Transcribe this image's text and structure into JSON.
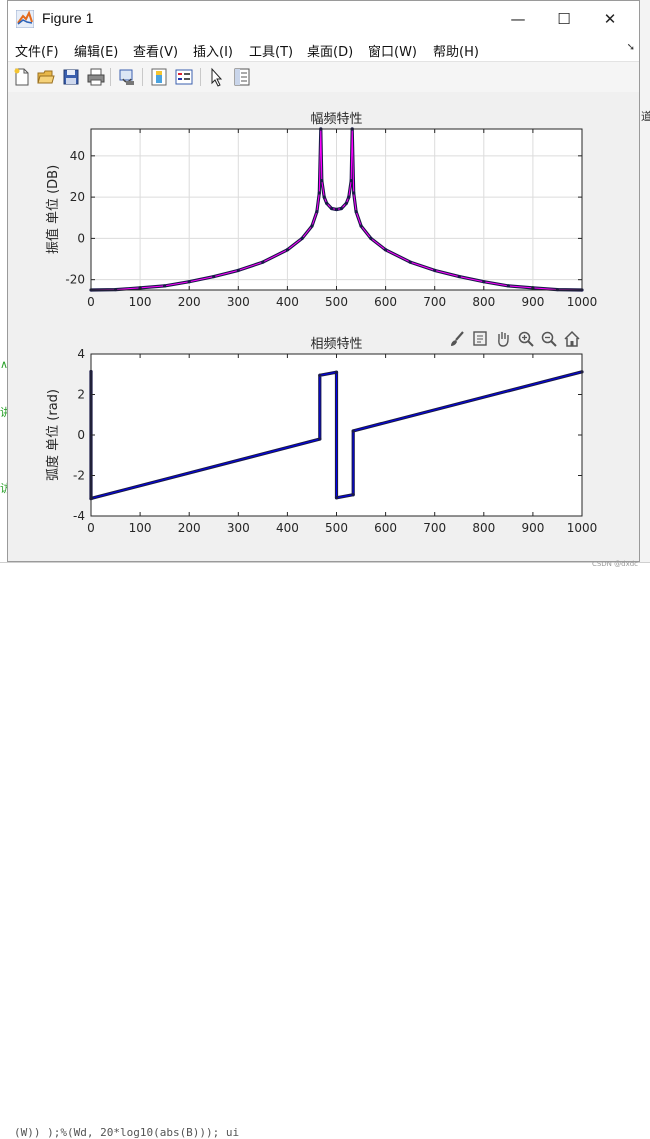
{
  "window": {
    "title": "Figure 1",
    "minimize": "—",
    "maximize": "☐",
    "close": "✕"
  },
  "menu": [
    {
      "label": "文件(F)"
    },
    {
      "label": "编辑(E)"
    },
    {
      "label": "查看(V)"
    },
    {
      "label": "插入(I)"
    },
    {
      "label": "工具(T)"
    },
    {
      "label": "桌面(D)"
    },
    {
      "label": "窗口(W)"
    },
    {
      "label": "帮助(H)"
    }
  ],
  "toolbar": {
    "icons": [
      "new-figure-icon",
      "open-file-icon",
      "save-icon",
      "print-icon",
      "link-plot-icon",
      "insert-colorbar-icon",
      "insert-legend-icon",
      "edit-plot-icon",
      "property-inspector-icon"
    ]
  },
  "axes_toolbar": {
    "icons": [
      "brush-icon",
      "data-tips-icon",
      "pan-icon",
      "zoom-in-icon",
      "zoom-out-icon",
      "home-icon"
    ]
  },
  "chart_data": [
    {
      "type": "line",
      "title": "幅频特性",
      "xlabel": "",
      "ylabel": "振值  单位 (DB)",
      "xlim": [
        0,
        1000
      ],
      "ylim": [
        -25,
        53
      ],
      "xticks": [
        0,
        100,
        200,
        300,
        400,
        500,
        600,
        700,
        800,
        900,
        1000
      ],
      "yticks": [
        -20,
        0,
        20,
        40
      ],
      "grid": true,
      "series": [
        {
          "color": "#ff00ff",
          "marker_color": "#1a1a4a",
          "x": [
            0,
            50,
            100,
            150,
            200,
            250,
            300,
            350,
            400,
            430,
            450,
            460,
            465,
            468,
            470,
            475,
            480,
            490,
            500,
            510,
            520,
            525,
            530,
            532,
            535,
            540,
            550,
            570,
            600,
            650,
            700,
            750,
            800,
            850,
            900,
            950,
            1000
          ],
          "values": [
            -25,
            -24.8,
            -24,
            -23,
            -21,
            -18.5,
            -15.5,
            -11.5,
            -5.5,
            0,
            6,
            13,
            22,
            53,
            28,
            20,
            17,
            14.5,
            14,
            14.5,
            17,
            20,
            28,
            53,
            22,
            13,
            6,
            0,
            -5.5,
            -11.5,
            -15.5,
            -18.5,
            -21,
            -23,
            -24,
            -24.8,
            -25
          ]
        }
      ]
    },
    {
      "type": "line",
      "title": "相频特性",
      "xlabel": "",
      "ylabel": "弧度  单位 (rad)",
      "xlim": [
        0,
        1000
      ],
      "ylim": [
        -4,
        4
      ],
      "xticks": [
        0,
        100,
        200,
        300,
        400,
        500,
        600,
        700,
        800,
        900,
        1000
      ],
      "yticks": [
        -4,
        -2,
        0,
        2,
        4
      ],
      "grid": false,
      "series": [
        {
          "color": "#0000ee",
          "marker_color": "#1a1a4a",
          "x": [
            0,
            0,
            2,
            466,
            466,
            500,
            500,
            534,
            534,
            1000
          ],
          "values": [
            3.14,
            -3.14,
            -3.12,
            -0.2,
            2.95,
            3.1,
            -3.1,
            -2.95,
            0.2,
            3.12
          ]
        }
      ]
    }
  ],
  "background": {
    "bottom_code": "(W)) );%(Wd, 20*log10(abs(B))); ui"
  },
  "watermark": "CSDN @dxdc"
}
